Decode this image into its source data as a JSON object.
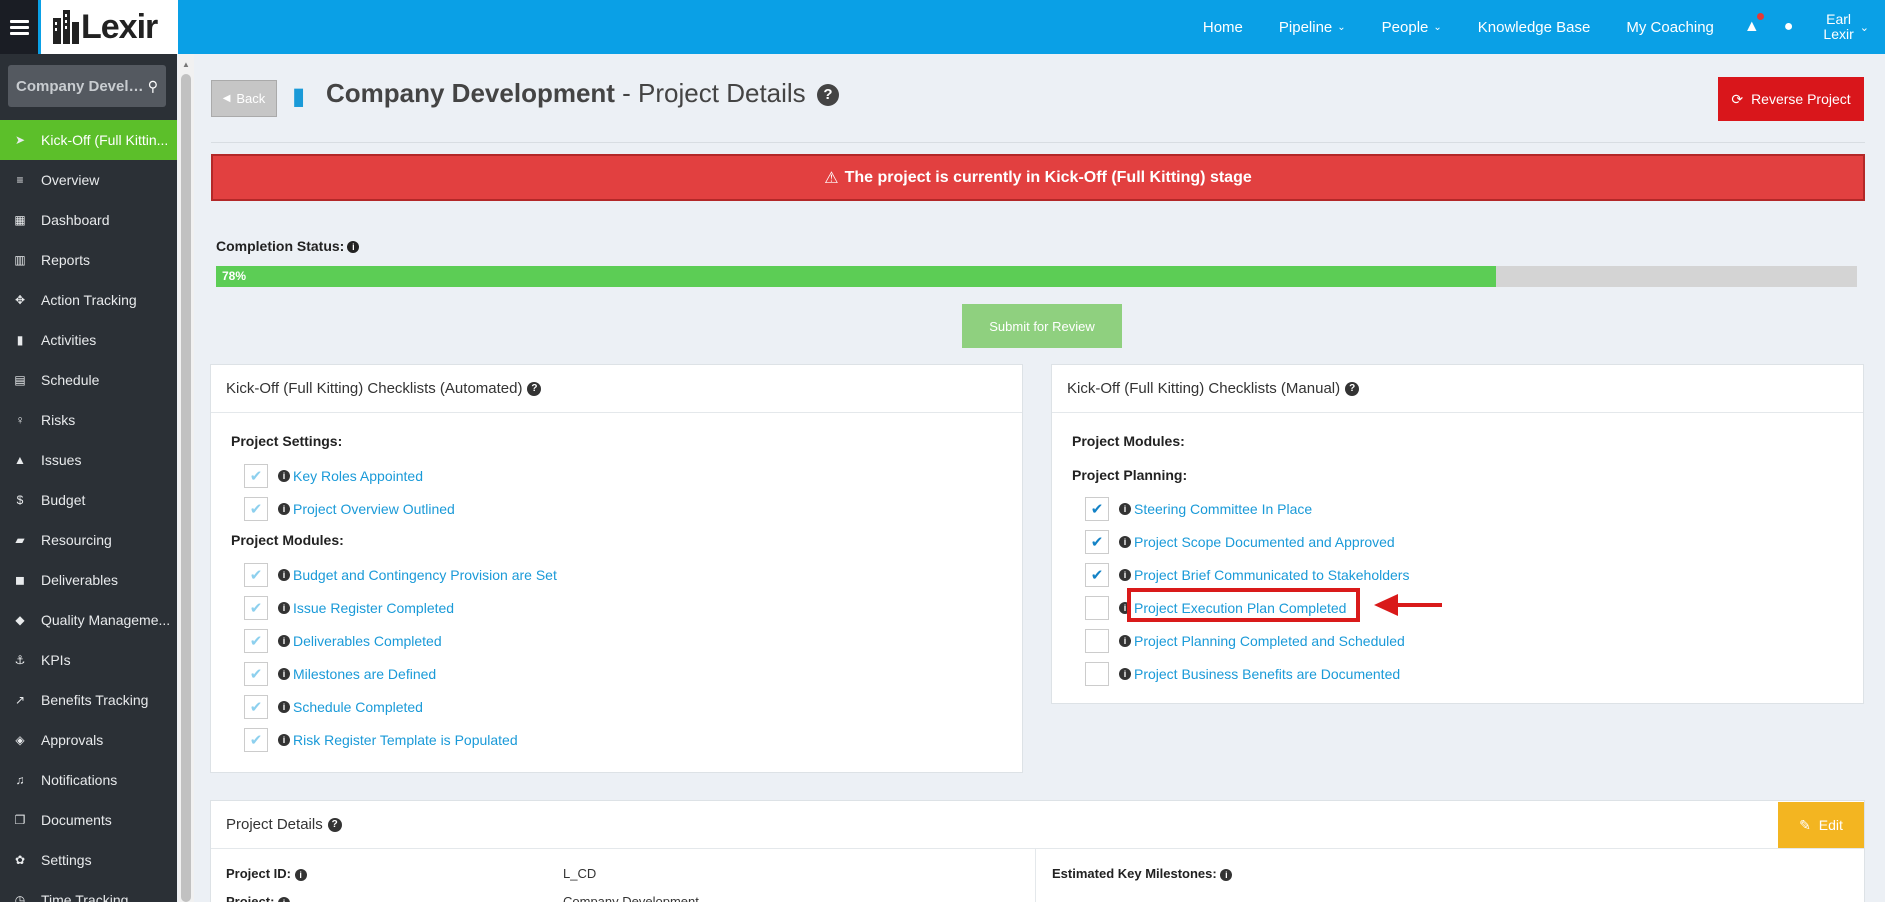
{
  "brand": {
    "logo_text": "Lexir"
  },
  "colors": {
    "topbar": "#0aa0e6",
    "sidebar": "#2b3036",
    "active": "#5cbf2a",
    "alert": "#e24040",
    "link": "#1a9ad8",
    "progress": "#5ccd55",
    "reverse": "#d9161b",
    "edit": "#f3b521"
  },
  "nav": {
    "home": "Home",
    "pipeline": "Pipeline",
    "people": "People",
    "knowledge_base": "Knowledge Base",
    "my_coaching": "My Coaching",
    "user_first": "Earl",
    "user_last": "Lexir"
  },
  "sidebar": {
    "search_text": "Company Develo...",
    "items": [
      {
        "label": "Kick-Off (Full Kittin...",
        "icon": "rocket-icon",
        "glyph": "➤"
      },
      {
        "label": "Overview",
        "icon": "list-icon",
        "glyph": "≡"
      },
      {
        "label": "Dashboard",
        "icon": "dashboard-icon",
        "glyph": "▦"
      },
      {
        "label": "Reports",
        "icon": "bar-chart-icon",
        "glyph": "▥"
      },
      {
        "label": "Action Tracking",
        "icon": "crosshair-icon",
        "glyph": "✥"
      },
      {
        "label": "Activities",
        "icon": "bookmark-icon",
        "glyph": "▮"
      },
      {
        "label": "Schedule",
        "icon": "calendar-icon",
        "glyph": "▤"
      },
      {
        "label": "Risks",
        "icon": "lightbulb-icon",
        "glyph": "♀"
      },
      {
        "label": "Issues",
        "icon": "warning-icon",
        "glyph": "▲"
      },
      {
        "label": "Budget",
        "icon": "dollar-icon",
        "glyph": "$"
      },
      {
        "label": "Resourcing",
        "icon": "folder-icon",
        "glyph": "▰"
      },
      {
        "label": "Deliverables",
        "icon": "truck-icon",
        "glyph": "◼"
      },
      {
        "label": "Quality Manageme...",
        "icon": "tag-icon",
        "glyph": "◆"
      },
      {
        "label": "KPIs",
        "icon": "anchor-icon",
        "glyph": "⚓"
      },
      {
        "label": "Benefits Tracking",
        "icon": "line-chart-icon",
        "glyph": "↗"
      },
      {
        "label": "Approvals",
        "icon": "tags-icon",
        "glyph": "◈"
      },
      {
        "label": "Notifications",
        "icon": "bell-icon",
        "glyph": "♫"
      },
      {
        "label": "Documents",
        "icon": "copy-icon",
        "glyph": "❐"
      },
      {
        "label": "Settings",
        "icon": "cogs-icon",
        "glyph": "✿"
      },
      {
        "label": "Time Tracking",
        "icon": "clock-icon",
        "glyph": "◷"
      }
    ]
  },
  "header": {
    "back": "Back",
    "title_bold": "Company Development",
    "title_rest": " - Project Details",
    "help": "?",
    "reverse": "Reverse Project"
  },
  "alert": {
    "text": "The project is currently in Kick-Off (Full Kitting) stage"
  },
  "completion": {
    "label": "Completion Status:",
    "percent": 78,
    "percent_label": "78%"
  },
  "submit": "Submit for Review",
  "auto_panel": {
    "title": "Kick-Off (Full Kitting) Checklists (Automated)",
    "settings_label": "Project Settings:",
    "settings_items": [
      "Key Roles Appointed",
      "Project Overview Outlined"
    ],
    "modules_label": "Project Modules:",
    "modules_items": [
      "Budget and Contingency Provision are Set",
      "Issue Register Completed",
      "Deliverables Completed",
      "Milestones are Defined",
      "Schedule Completed",
      "Risk Register Template is Populated"
    ]
  },
  "manual_panel": {
    "title": "Kick-Off (Full Kitting) Checklists (Manual)",
    "modules_label": "Project Modules:",
    "planning_label": "Project Planning:",
    "items": [
      {
        "label": "Steering Committee In Place",
        "checked": true
      },
      {
        "label": "Project Scope Documented and Approved",
        "checked": true
      },
      {
        "label": "Project Brief Communicated to Stakeholders",
        "checked": true
      },
      {
        "label": "Project Execution Plan Completed",
        "checked": false
      },
      {
        "label": "Project Planning Completed and Scheduled",
        "checked": false
      },
      {
        "label": "Project Business Benefits are Documented",
        "checked": false
      }
    ]
  },
  "details": {
    "title": "Project Details",
    "edit": "Edit",
    "project_id_label": "Project ID:",
    "project_id": "L_CD",
    "project_label": "Project:",
    "project": "Company Development",
    "milestones_label": "Estimated Key Milestones:"
  }
}
